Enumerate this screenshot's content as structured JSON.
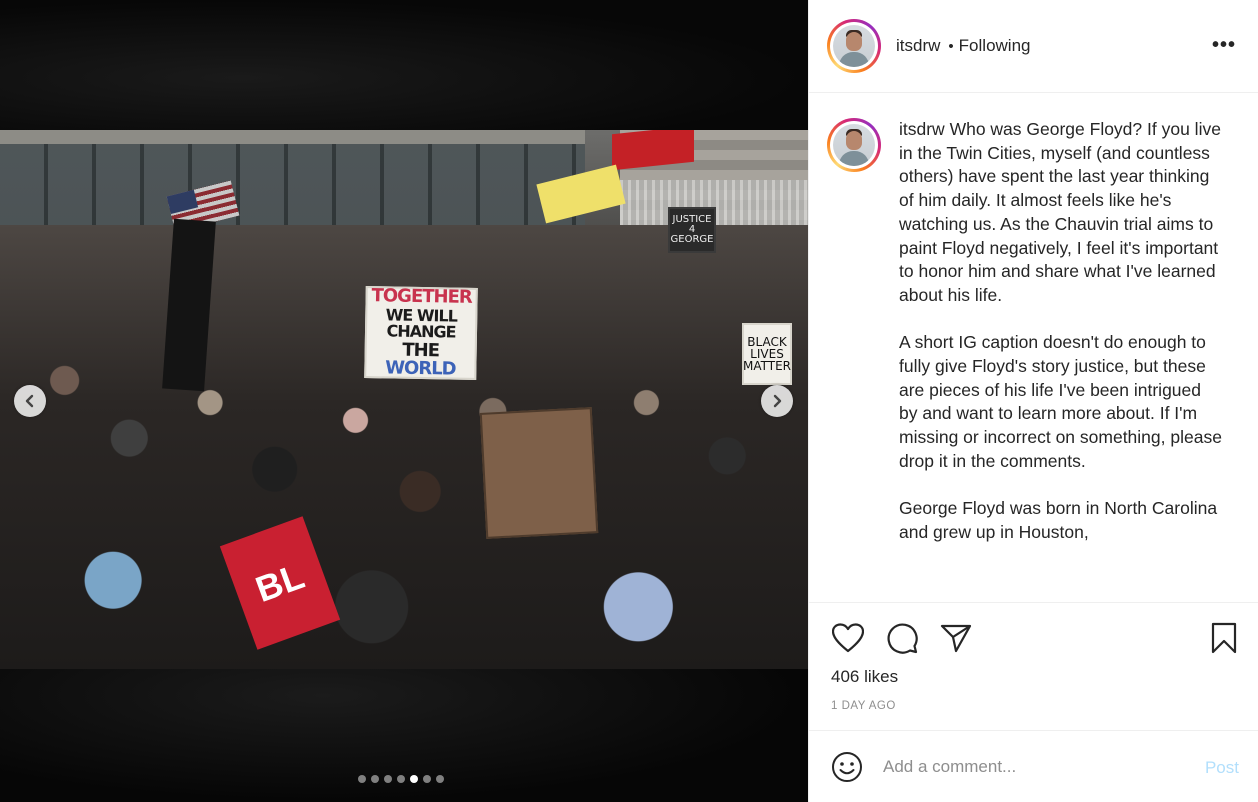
{
  "post": {
    "username": "itsdrw",
    "follow_status": "Following",
    "separator": "•",
    "more_label": "•••"
  },
  "media": {
    "sign_main": {
      "line1": "TOGETHER",
      "line2": "WE WILL CHANGE",
      "line3a": "THE ",
      "line3b": "WORLD"
    },
    "sign_black_lives": "BLACK LIVES MATTER",
    "sign_justice": "JUSTICE 4 GEORGE",
    "banner_red_text": "BL",
    "carousel": {
      "count": 7,
      "active_index": 4
    }
  },
  "caption": {
    "username": "itsdrw",
    "text": " Who was George Floyd? If you live in the Twin Cities, myself (and countless others) have spent the last year thinking of him daily. It almost feels like he's watching us. As the Chauvin trial aims to paint Floyd negatively, I feel it's important to honor him and share what I've learned about his life.\n\nA short IG caption doesn't do enough to fully give Floyd's story justice, but these are pieces of his life I've been intrigued by and want to learn more about. If I'm missing or incorrect on something, please drop it in the comments.\n\nGeorge Floyd was born in North Carolina and grew up in Houston,"
  },
  "engagement": {
    "likes": "406 likes",
    "timestamp": "1 DAY AGO"
  },
  "comment_box": {
    "placeholder": "Add a comment...",
    "post_label": "Post"
  },
  "icons": {
    "like": "heart-icon",
    "comment": "comment-icon",
    "share": "paper-plane-icon",
    "save": "bookmark-icon",
    "emoji": "smiley-icon",
    "prev": "chevron-left-icon",
    "next": "chevron-right-icon"
  },
  "colors": {
    "post_button": "#b2dffc",
    "text": "#262626",
    "muted": "#8e8e8e",
    "ring": [
      "#feda75",
      "#fa7e1e",
      "#d62976",
      "#962fbf"
    ]
  }
}
